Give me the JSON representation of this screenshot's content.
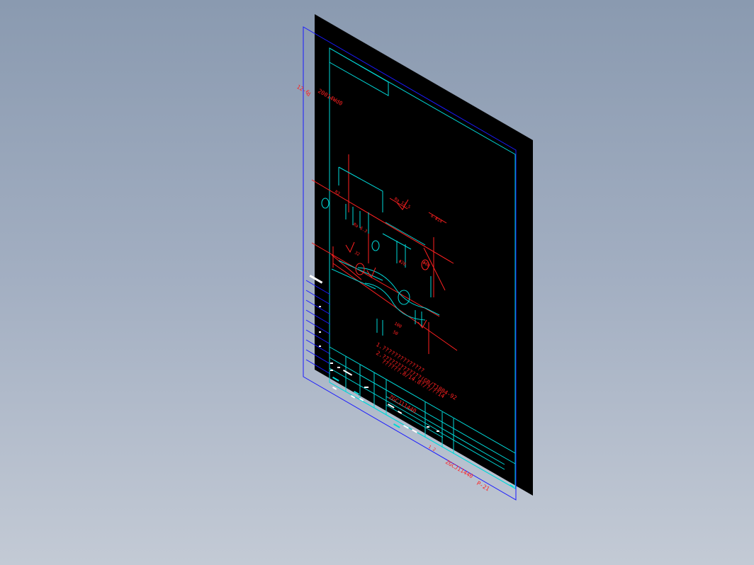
{
  "colors": {
    "background_top": "#8a9ab0",
    "background_bottom": "#c3cad5",
    "sheet": "#000000",
    "border_blue": "#1a1aff",
    "frame_cyan": "#00d8d8",
    "annotation_red": "#ff2020",
    "text_white": "#ffffff"
  },
  "drawing": {
    "top_label_line1": "12-6",
    "top_label_line2": "d",
    "top_code": "20014Wd0",
    "notes": {
      "line1": "1.??????????????",
      "line2": "2.?????????????(GB/T1804-92",
      "line3": "??????.8/14.8?/?/??14"
    },
    "title_block": {
      "drawing_number": "ZGCJ11440",
      "bottom_code": "ZGCJ11440",
      "bottom_suffix": "P-21",
      "scale": "1:1",
      "sheet_mark": "1 2"
    },
    "dimension_labels": [
      "Ra 12.5",
      "Ra 6.3",
      "4-Φ14",
      "Φ60",
      "32",
      "Φ20",
      "100",
      "50",
      "R3"
    ]
  }
}
